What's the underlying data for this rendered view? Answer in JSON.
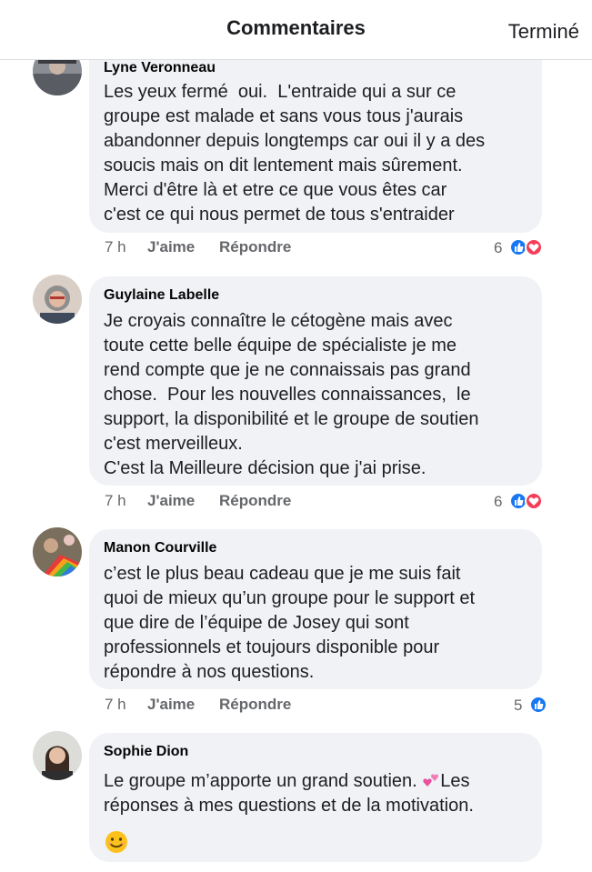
{
  "header": {
    "title": "Commentaires",
    "done_label": "Terminé"
  },
  "comments": [
    {
      "author": "Lyne Veronneau",
      "text": "Les yeux fermé  oui.  L'entraide qui a sur ce\ngroupe est malade et sans vous tous j'aurais\nabandonner depuis longtemps car oui il y a des\nsoucis mais on dit lentement mais sûrement.\nMerci d'être là et etre ce que vous êtes car\nc'est ce qui nous permet de tous s'entraider",
      "time": "7 h",
      "like_label": "J'aime",
      "reply_label": "Répondre",
      "reaction_count": "6",
      "reactions": [
        "like-icon",
        "love-icon"
      ]
    },
    {
      "author": "Guylaine Labelle",
      "text": "Je croyais connaître le cétogène mais avec\ntoute cette belle équipe de spécialiste je me\nrend compte que je ne connaissais pas grand\nchose.  Pour les nouvelles connaissances,  le\nsupport, la disponibilité et le groupe de soutien\nc'est merveilleux.\nC'est la Meilleure décision que j'ai prise.",
      "time": "7 h",
      "like_label": "J'aime",
      "reply_label": "Répondre",
      "reaction_count": "6",
      "reactions": [
        "like-icon",
        "love-icon"
      ]
    },
    {
      "author": "Manon Courville",
      "text": "c’est le plus beau cadeau que je me suis fait\nquoi de mieux qu’un groupe pour le support et\nque dire de l’équipe de Josey qui sont\nprofessionnels et toujours disponible pour\nrépondre à nos questions.",
      "time": "7 h",
      "like_label": "J'aime",
      "reply_label": "Répondre",
      "reaction_count": "5",
      "reactions": [
        "like-icon"
      ]
    },
    {
      "author": "Sophie Dion",
      "text_part1": "Le groupe m’apporte un grand soutien. ",
      "text_part2": "Les\nréponses à mes questions et de la motivation.",
      "inline_emojis": [
        "two-hearts-emoji",
        "smiling-face-emoji"
      ]
    }
  ],
  "colors": {
    "bubble": "#f0f2f5",
    "like_blue": "#1877f2",
    "love_red": "#f33e58",
    "meta_gray": "#65676b"
  }
}
